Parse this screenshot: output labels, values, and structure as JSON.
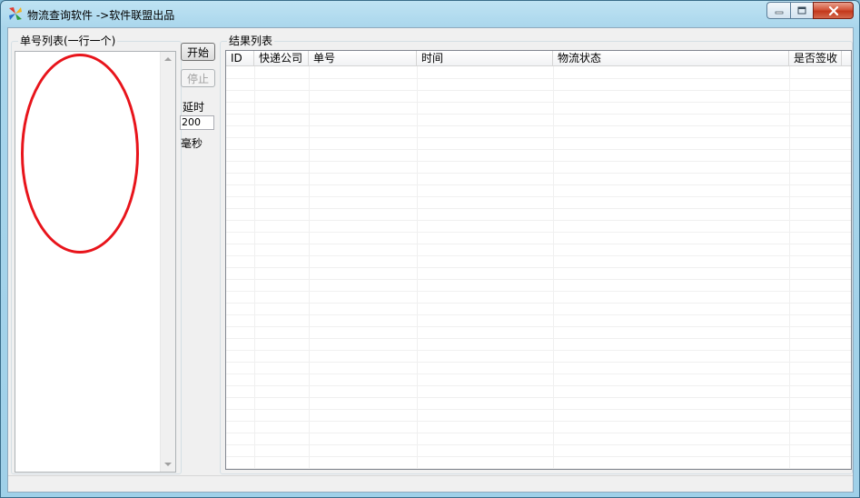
{
  "window": {
    "title": "物流查询软件 ->软件联盟出品"
  },
  "left_panel": {
    "group_title": "单号列表(一行一个)",
    "textarea_value": ""
  },
  "controls": {
    "start_label": "开始",
    "stop_label": "停止",
    "delay_label": "延时",
    "delay_value": "200",
    "unit_label": "毫秒"
  },
  "results": {
    "group_title": "结果列表",
    "columns": [
      "ID",
      "快递公司",
      "单号",
      "时间",
      "物流状态",
      "是否签收"
    ],
    "rows": []
  },
  "status_bar": {
    "text": ""
  },
  "colors": {
    "annotation": "#e8141b",
    "title_bar": "#a9d6ec"
  }
}
